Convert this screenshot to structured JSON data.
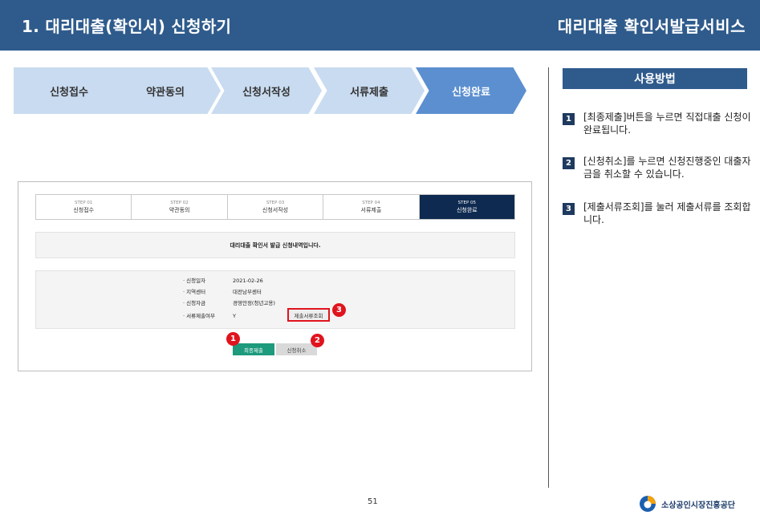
{
  "header": {
    "title": "1. 대리대출(확인서) 신청하기",
    "service": "대리대출 확인서발급서비스"
  },
  "steps": [
    "신청접수",
    "약관동의",
    "신청서작성",
    "서류제출",
    "신청완료"
  ],
  "active_step": 5,
  "usage": {
    "title": "사용방법",
    "items": [
      {
        "num": "1",
        "text": "[최종제출]버튼을 누르면 직접대출 신청이 완료됩니다."
      },
      {
        "num": "2",
        "text": "[신청취소]를 누르면 신청진행중인 대출자금을 취소할 수 있습니다."
      },
      {
        "num": "3",
        "text": "[제출서류조회]를 눌러 제출서류를 조회합니다."
      }
    ]
  },
  "screenshot": {
    "steps": [
      {
        "num": "STEP 01",
        "label": "신청접수"
      },
      {
        "num": "STEP 02",
        "label": "약관동의"
      },
      {
        "num": "STEP 03",
        "label": "신청서작성"
      },
      {
        "num": "STEP 04",
        "label": "서류제출"
      },
      {
        "num": "STEP 05",
        "label": "신청완료"
      }
    ],
    "notice": "대리대출 확인서 발급 신청내역입니다.",
    "details": [
      {
        "key": "· 신청일자",
        "value": "2021-02-26"
      },
      {
        "key": "· 지역센터",
        "value": "대전남부센터"
      },
      {
        "key": "· 신청자금",
        "value": "경영안정(청년고용)"
      },
      {
        "key": "· 서류제출여부",
        "value": "Y"
      }
    ],
    "doc_button": "제출서류조회",
    "submit_button": "최종제출",
    "cancel_button": "신청취소",
    "badges": [
      "1",
      "2",
      "3"
    ]
  },
  "footer": {
    "page_number": "51",
    "org": "소상공인시장진흥공단"
  },
  "colors": {
    "header_bg": "#2f5b8c",
    "step_inactive": "#c9dbf0",
    "step_active": "#5b8fd0",
    "badge": "#e0141e",
    "submit": "#1e9a7c"
  }
}
